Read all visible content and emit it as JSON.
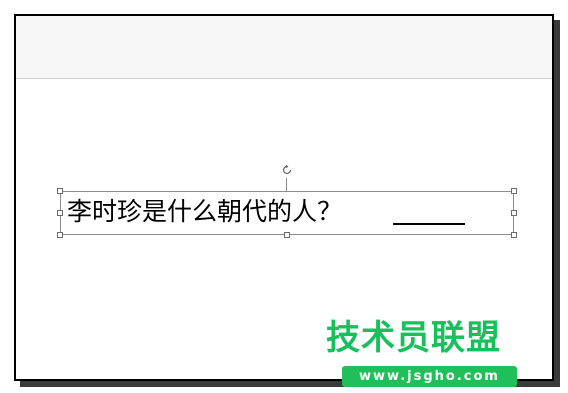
{
  "slide": {
    "question": "李时珍是什么朝代的人？",
    "blank": "______"
  },
  "watermark": {
    "title": "技术员联盟",
    "url": "www.jsgho.com",
    "color": "#1fc05a"
  },
  "icons": {
    "rotate": "rotate-handle-icon"
  }
}
